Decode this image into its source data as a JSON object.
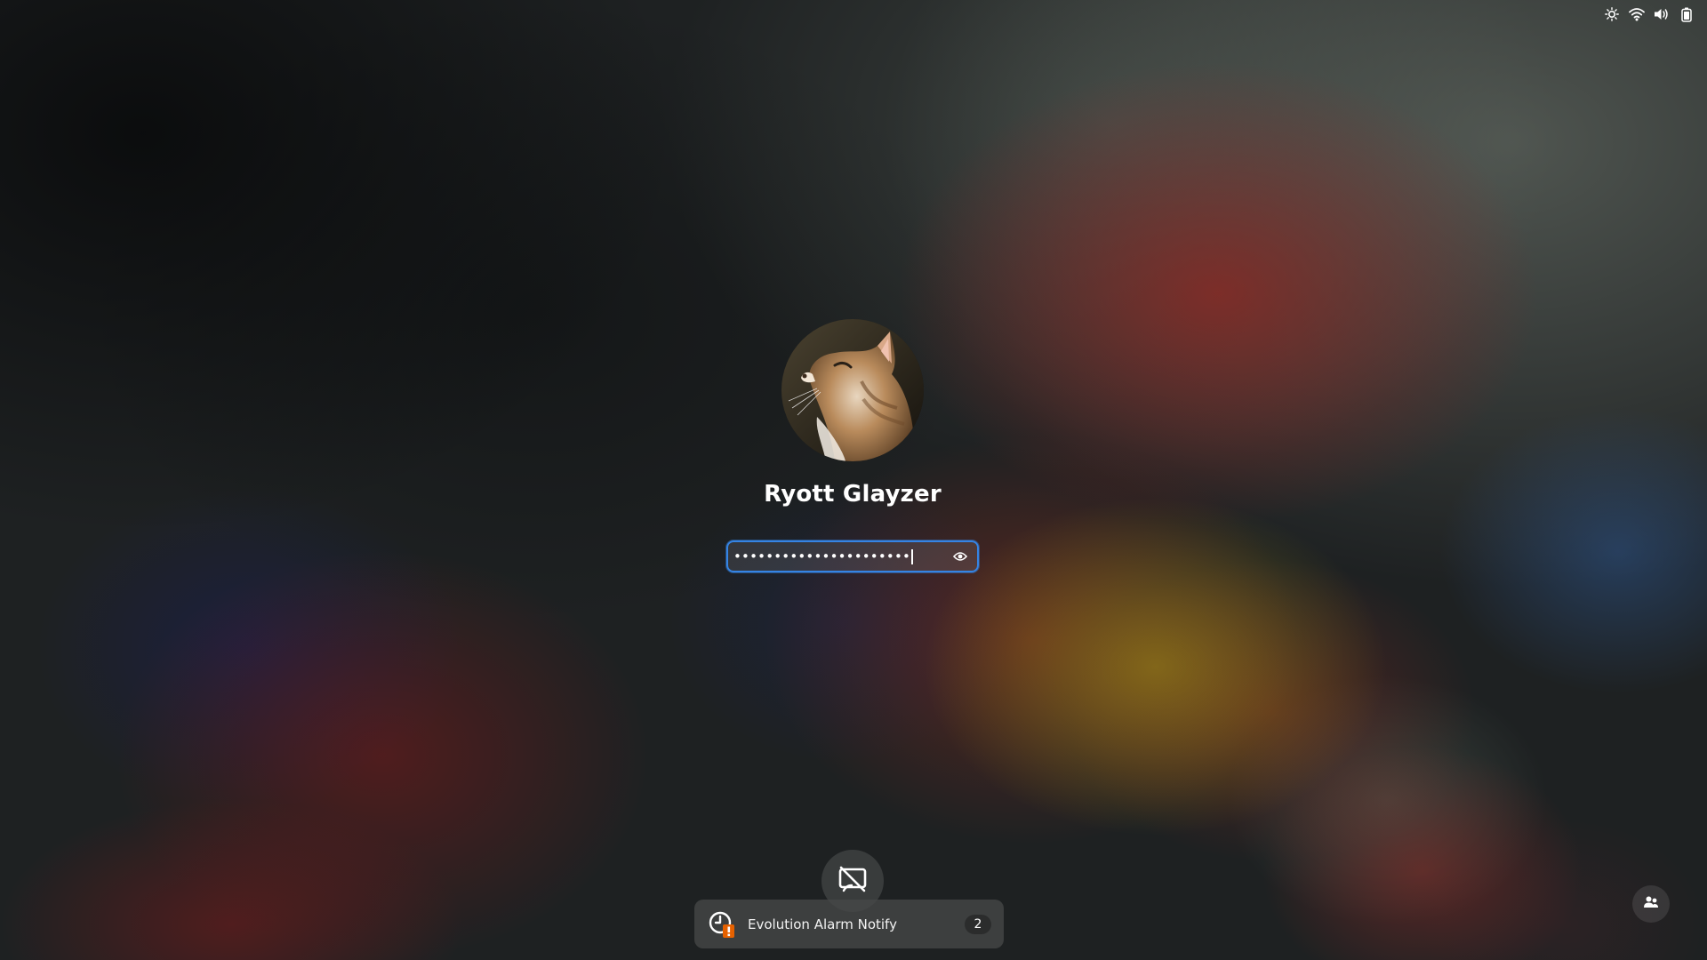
{
  "top_bar": {
    "status_icons": [
      "brightness-icon",
      "wifi-icon",
      "volume-icon",
      "battery-icon"
    ]
  },
  "login": {
    "user_name": "Ryott Glayzer",
    "password_mask": "••••••••••••••••••••••",
    "reveal_icon": "eye-icon"
  },
  "bottom": {
    "screen_share_icon": "screen-share-off-icon",
    "switch_user_icon": "switch-user-icon"
  },
  "notification": {
    "title": "Evolution Alarm Notify",
    "count": "2",
    "icon": "alarm-clock-warning-icon"
  },
  "colors": {
    "focus_accent": "#3584e4",
    "alarm_badge": "#e66100"
  }
}
